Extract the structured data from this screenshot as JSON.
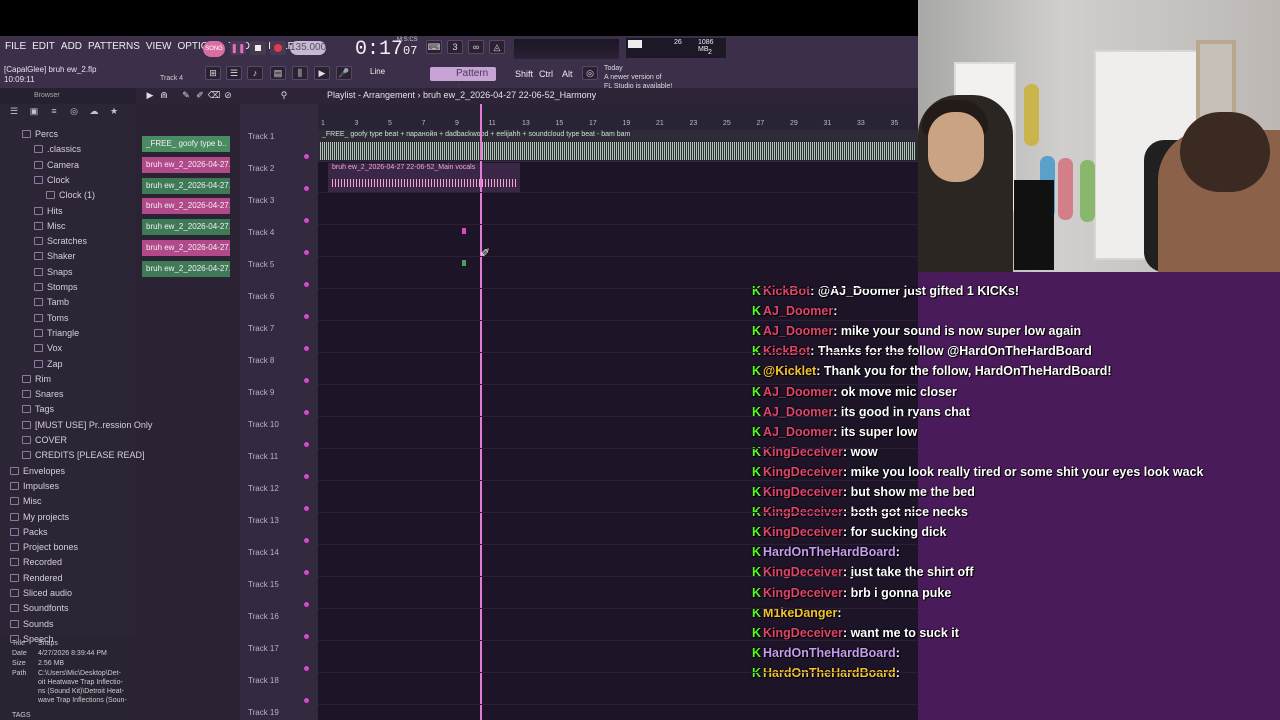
{
  "menu": [
    "FILE",
    "EDIT",
    "ADD",
    "PATTERNS",
    "VIEW",
    "OPTIONS",
    "TOOLS",
    "HELP"
  ],
  "transport": {
    "song": "SONG",
    "bpm": "135.000",
    "time": "0:17",
    "time_frac": "07",
    "time_label": "M:S:CS",
    "cpu": "26",
    "mem": "1086 MB",
    "voices": "2"
  },
  "project": {
    "file": "[CapalGlee] bruh ew_2.flp",
    "elapsed": "10:09:11",
    "track_hint": "Track 4"
  },
  "toolbar": {
    "snap": "Line",
    "pattern": "Pattern 1",
    "shift": "Shift",
    "ctrl": "Ctrl",
    "alt": "Alt",
    "news": [
      "Today",
      "A newer version of",
      "FL Studio is available!"
    ]
  },
  "browser": {
    "title": "Browser",
    "items": [
      {
        "label": "Percs",
        "indent": 1
      },
      {
        "label": ".classics",
        "indent": 2
      },
      {
        "label": "Camera",
        "indent": 2
      },
      {
        "label": "Clock",
        "indent": 2
      },
      {
        "label": "Clock (1)",
        "indent": 3
      },
      {
        "label": "Hits",
        "indent": 2
      },
      {
        "label": "Misc",
        "indent": 2
      },
      {
        "label": "Scratches",
        "indent": 2
      },
      {
        "label": "Shaker",
        "indent": 2
      },
      {
        "label": "Snaps",
        "indent": 2
      },
      {
        "label": "Stomps",
        "indent": 2
      },
      {
        "label": "Tamb",
        "indent": 2
      },
      {
        "label": "Toms",
        "indent": 2
      },
      {
        "label": "Triangle",
        "indent": 2
      },
      {
        "label": "Vox",
        "indent": 2
      },
      {
        "label": "Zap",
        "indent": 2
      },
      {
        "label": "Rim",
        "indent": 1
      },
      {
        "label": "Snares",
        "indent": 1
      },
      {
        "label": "Tags",
        "indent": 1
      },
      {
        "label": "[MUST USE] Pr..ression Only",
        "indent": 1
      },
      {
        "label": "COVER",
        "indent": 1
      },
      {
        "label": "CREDITS [PLEASE READ]",
        "indent": 1
      },
      {
        "label": "Envelopes",
        "indent": 0
      },
      {
        "label": "Impulses",
        "indent": 0
      },
      {
        "label": "Misc",
        "indent": 0
      },
      {
        "label": "My projects",
        "indent": 0
      },
      {
        "label": "Packs",
        "indent": 0
      },
      {
        "label": "Project bones",
        "indent": 0
      },
      {
        "label": "Recorded",
        "indent": 0
      },
      {
        "label": "Rendered",
        "indent": 0
      },
      {
        "label": "Sliced audio",
        "indent": 0
      },
      {
        "label": "Soundfonts",
        "indent": 0
      },
      {
        "label": "Sounds",
        "indent": 0
      },
      {
        "label": "Speech",
        "indent": 0
      }
    ],
    "info": {
      "title_k": "Title",
      "title_v": "Snaps",
      "date_k": "Date",
      "date_v": "4/27/2026 8:39:44 PM",
      "size_k": "Size",
      "size_v": "2.56 MB",
      "path_k": "Path",
      "path_v": [
        "C:\\Users\\Mic\\Desktop\\Det-",
        "oit Heatwave Trap Inflectio-",
        "ns (Sound Kit)\\Detroit Heat-",
        "wave Trap Inflections (Soun-"
      ],
      "tags": "TAGS"
    }
  },
  "channels": [
    "_FREE_ goofy type b..",
    "bruh ew_2_2026-04-27..",
    "bruh ew_2_2026-04-27..",
    "bruh ew_2_2026-04-27..",
    "bruh ew_2_2026-04-27..",
    "bruh ew_2_2026-04-27..",
    "bruh ew_2_2026-04-27.."
  ],
  "playlist": {
    "title": "Playlist - Arrangement",
    "path": "bruh ew_2_2026-04-27 22-06-52_Harmony",
    "tracks": [
      "Track 1",
      "Track 2",
      "Track 3",
      "Track 4",
      "Track 5",
      "Track 6",
      "Track 7",
      "Track 8",
      "Track 9",
      "Track 10",
      "Track 11",
      "Track 12",
      "Track 13",
      "Track 14",
      "Track 15",
      "Track 16",
      "Track 17",
      "Track 18",
      "Track 19"
    ],
    "ruler": [
      "1",
      "3",
      "5",
      "7",
      "9",
      "11",
      "13",
      "15",
      "17",
      "19",
      "21",
      "23",
      "25",
      "27",
      "29",
      "31",
      "33",
      "35"
    ],
    "clip1": "_FREE_ goofy type beat + паранойя + dadbackwood + eelijahh + soundcloud type beat - bam bam",
    "clip2": "bruh ew_2_2026-04-27 22-06-52_Main vocals"
  },
  "chat": [
    {
      "user": "KickBot",
      "msg": "@AJ_Doomer just gifted 1 KICKs!",
      "color": "#e0446a"
    },
    {
      "user": "AJ_Doomer",
      "msg": "",
      "color": "#e0446a"
    },
    {
      "user": "AJ_Doomer",
      "msg": "mike your sound is now super low again",
      "color": "#e0446a"
    },
    {
      "user": "KickBot",
      "msg": "Thanks for the follow @HardOnTheHardBoard",
      "color": "#e0446a"
    },
    {
      "user": "@Kicklet",
      "msg": "Thank you for the follow, HardOnTheHardBoard!",
      "color": "#f3c32d"
    },
    {
      "user": "AJ_Doomer",
      "msg": "ok move mic closer",
      "color": "#e0446a"
    },
    {
      "user": "AJ_Doomer",
      "msg": "its good in ryans chat",
      "color": "#e0446a"
    },
    {
      "user": "AJ_Doomer",
      "msg": "its super low",
      "color": "#e0446a"
    },
    {
      "user": "KingDeceiver",
      "msg": "wow",
      "color": "#e0446a"
    },
    {
      "user": "KingDeceiver",
      "msg": "mike you look really tired or some shit your eyes look wack",
      "color": "#e0446a"
    },
    {
      "user": "KingDeceiver",
      "msg": "but show me the bed",
      "color": "#e0446a"
    },
    {
      "user": "KingDeceiver",
      "msg": "both got nice necks",
      "color": "#e0446a"
    },
    {
      "user": "KingDeceiver",
      "msg": "for sucking dick",
      "color": "#e0446a"
    },
    {
      "user": "HardOnTheHardBoard",
      "msg": "",
      "color": "#c79cf0"
    },
    {
      "user": "KingDeceiver",
      "msg": "just take the shirt off",
      "color": "#e0446a"
    },
    {
      "user": "KingDeceiver",
      "msg": "brb i gonna puke",
      "color": "#e0446a"
    },
    {
      "user": "M1keDanger",
      "msg": "",
      "color": "#f3c32d"
    },
    {
      "user": "KingDeceiver",
      "msg": "want me to suck it",
      "color": "#e0446a"
    },
    {
      "user": "HardOnTheHardBoard",
      "msg": "",
      "color": "#c79cf0"
    },
    {
      "user": "HardOnTheHardBoard",
      "msg": "",
      "color": "#f3c32d"
    }
  ]
}
